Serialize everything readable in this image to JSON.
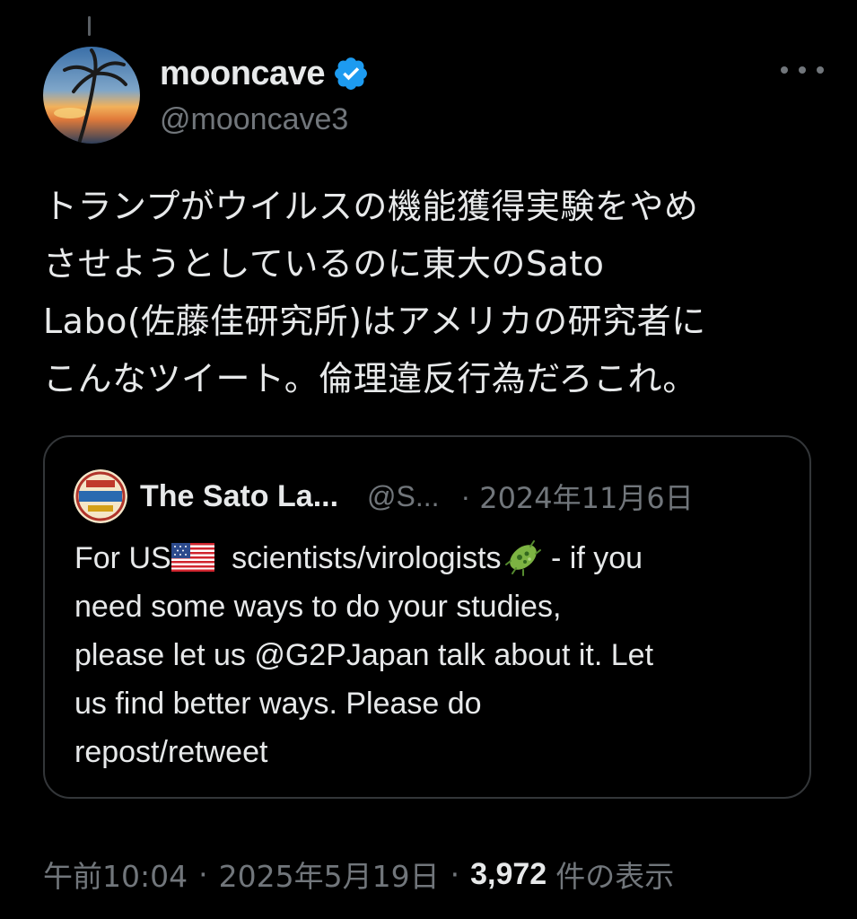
{
  "tweet": {
    "author": {
      "display_name": "mooncave",
      "handle": "@mooncave3",
      "verified": true,
      "verified_color": "#1d9bf0"
    },
    "text_lines": [
      "トランプがウイルスの機能獲得実験をやめ",
      "させようとしているのに東大のSato",
      "Labo(佐藤佳研究所)はアメリカの研究者に",
      "こんなツイート。倫理違反行為だろこれ。"
    ],
    "quote": {
      "display_name": "The Sato La...",
      "handle": "@S...",
      "separator": "·",
      "date": "2024年11月6日",
      "text": {
        "line1_a": "For US",
        "line1_b": " scientists/virologists",
        "line1_c": " - if you",
        "line2": "need some ways to do your studies,",
        "line3": "please let us @G2PJapan talk about it. Let",
        "line4": "us find better ways. Please do",
        "line5": "repost/retweet"
      },
      "emoji": [
        "us-flag-icon",
        "microbe-icon"
      ]
    },
    "footer": {
      "time": "午前10:04",
      "separator": "·",
      "date": "2025年5月19日",
      "views_count": "3,972",
      "views_label": "件の表示"
    }
  },
  "colors": {
    "background": "#000000",
    "primary_text": "#e7e9ea",
    "secondary_text": "#71767b",
    "border": "#333639",
    "accent": "#1d9bf0"
  }
}
